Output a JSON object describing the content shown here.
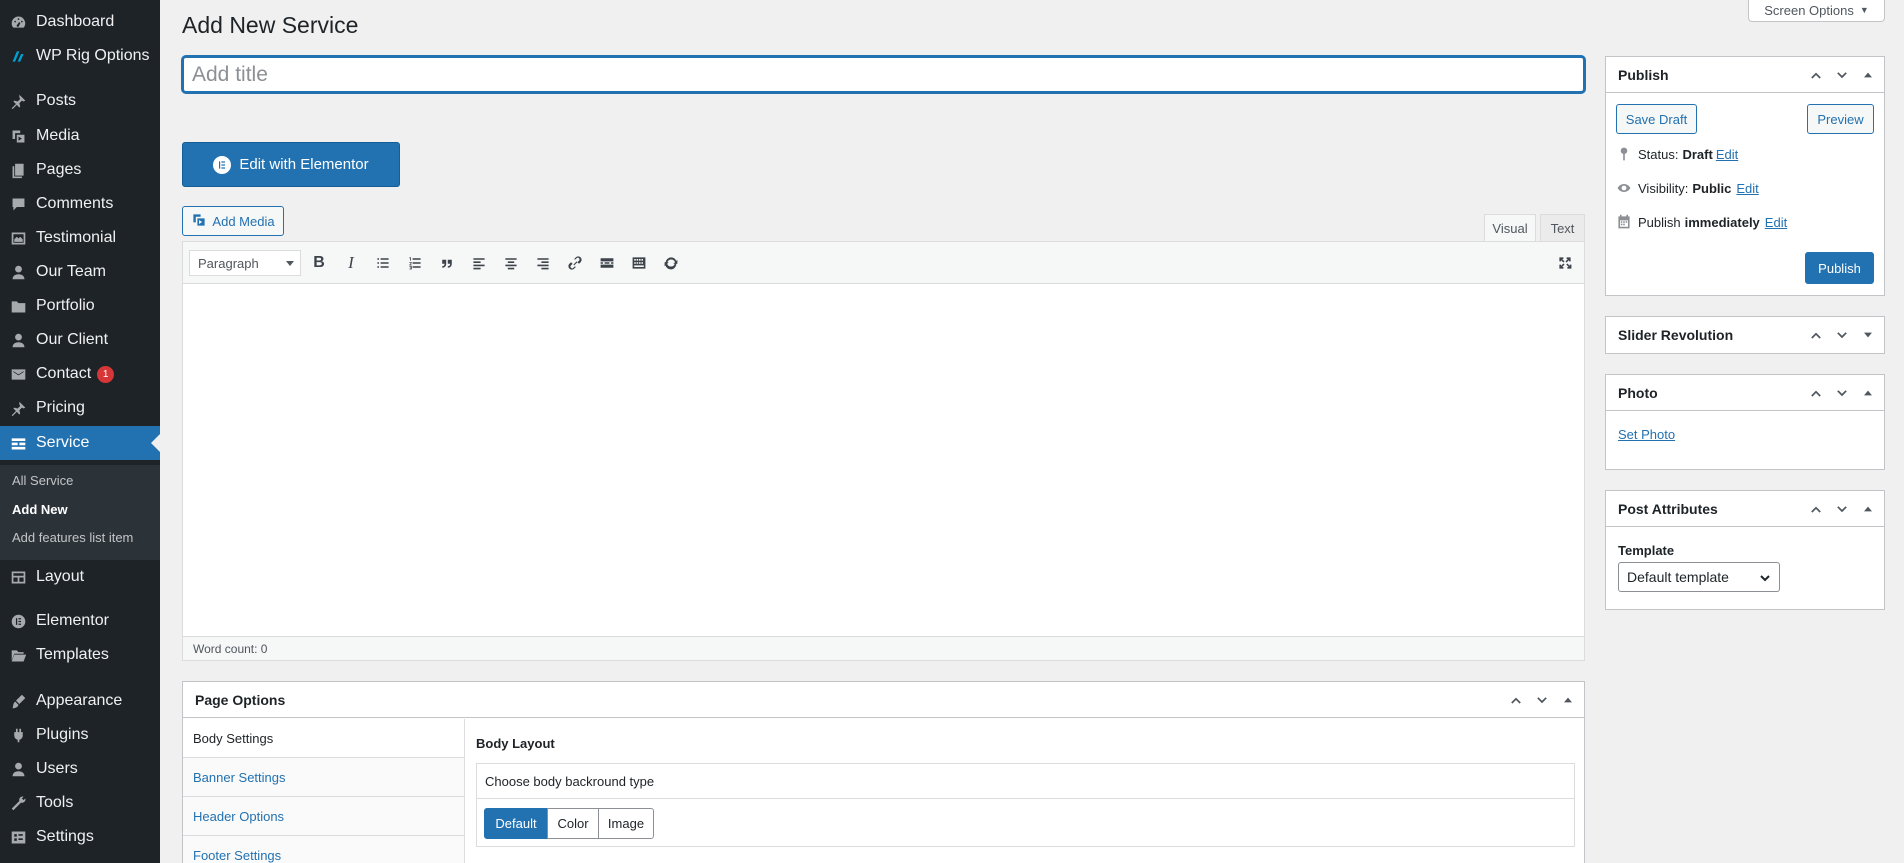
{
  "sidebar": {
    "items": [
      {
        "label": "Dashboard",
        "icon": "dashboard-icon"
      },
      {
        "label": "WP Rig Options",
        "icon": "wp-rig-icon"
      },
      {
        "label": "Posts",
        "icon": "pin-icon"
      },
      {
        "label": "Media",
        "icon": "media-icon"
      },
      {
        "label": "Pages",
        "icon": "pages-icon"
      },
      {
        "label": "Comments",
        "icon": "comment-icon"
      },
      {
        "label": "Testimonial",
        "icon": "testimonial-icon"
      },
      {
        "label": "Our Team",
        "icon": "person-icon"
      },
      {
        "label": "Portfolio",
        "icon": "folder-icon"
      },
      {
        "label": "Our Client",
        "icon": "person-icon"
      },
      {
        "label": "Contact",
        "icon": "mail-icon",
        "badge": "1"
      },
      {
        "label": "Pricing",
        "icon": "pin-icon"
      },
      {
        "label": "Service",
        "icon": "service-icon"
      },
      {
        "label": "Layout",
        "icon": "layout-icon"
      },
      {
        "label": "Elementor",
        "icon": "elementor-icon"
      },
      {
        "label": "Templates",
        "icon": "folder-open-icon"
      },
      {
        "label": "Appearance",
        "icon": "brush-icon"
      },
      {
        "label": "Plugins",
        "icon": "plugin-icon"
      },
      {
        "label": "Users",
        "icon": "person-icon"
      },
      {
        "label": "Tools",
        "icon": "wrench-icon"
      },
      {
        "label": "Settings",
        "icon": "settings-icon"
      }
    ],
    "submenu": [
      "All Service",
      "Add New",
      "Add features list item"
    ]
  },
  "header": {
    "title": "Add New Service",
    "screen_options": "Screen Options"
  },
  "editor": {
    "title_placeholder": "Add title",
    "elementor_button": "Edit with Elementor",
    "add_media": "Add Media",
    "tab_visual": "Visual",
    "tab_text": "Text",
    "format": "Paragraph",
    "word_count": "Word count: 0"
  },
  "page_options": {
    "title": "Page Options",
    "nav": [
      "Body Settings",
      "Banner Settings",
      "Header Options",
      "Footer Settings"
    ],
    "body_layout": "Body Layout",
    "bg_prompt": "Choose body backround type",
    "bg_options": [
      "Default",
      "Color",
      "Image"
    ],
    "bg_selected": "Default"
  },
  "publish": {
    "title": "Publish",
    "save_draft": "Save Draft",
    "preview": "Preview",
    "status_label": "Status:",
    "status_value": "Draft",
    "visibility_label": "Visibility:",
    "visibility_value": "Public",
    "publish_label": "Publish",
    "publish_value": "immediately",
    "edit": "Edit",
    "publish_button": "Publish"
  },
  "slider_revolution": {
    "title": "Slider Revolution"
  },
  "photo": {
    "title": "Photo",
    "set_photo": "Set Photo"
  },
  "post_attributes": {
    "title": "Post Attributes",
    "template_label": "Template",
    "template_value": "Default template"
  },
  "colors": {
    "accent": "#2271b1",
    "sidebar": "#1d2327",
    "badge": "#d63638"
  }
}
